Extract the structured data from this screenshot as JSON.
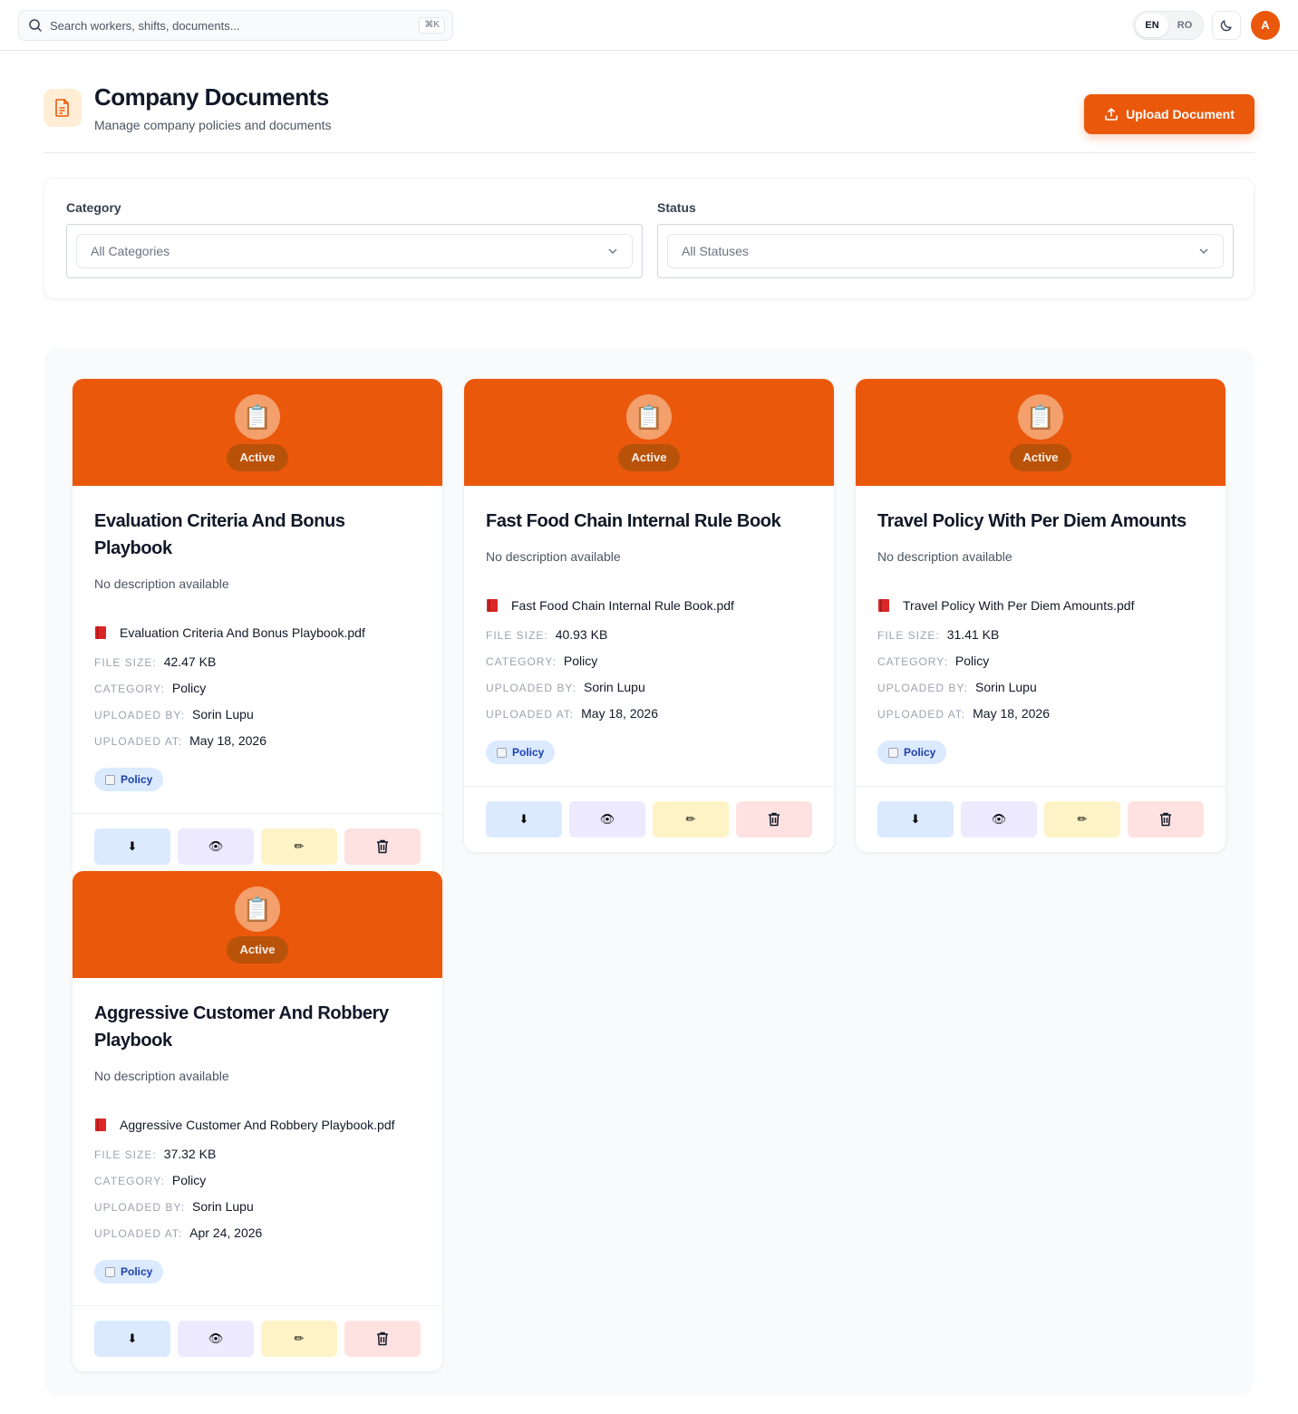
{
  "topbar": {
    "search_placeholder": "Search workers, shifts, documents...",
    "shortcut": "⌘K",
    "lang": [
      "EN",
      "RO"
    ],
    "avatar_initial": "A"
  },
  "header": {
    "title": "Company Documents",
    "subtitle": "Manage company policies and documents",
    "upload_label": "Upload Document"
  },
  "filters": {
    "category_label": "Category",
    "category_value": "All Categories",
    "status_label": "Status",
    "status_value": "All Statuses"
  },
  "labels": {
    "file_size": "FILE SIZE:",
    "category": "CATEGORY:",
    "uploaded_by": "UPLOADED BY:",
    "uploaded_at": "UPLOADED AT:"
  },
  "colors": {
    "accent": "#ea580c"
  },
  "documents": [
    {
      "status": "Active",
      "title": "Evaluation Criteria And Bonus Playbook",
      "description": "No description available",
      "file_name": "Evaluation Criteria And Bonus Playbook.pdf",
      "file_size": "42.47 KB",
      "category": "Policy",
      "uploaded_by": "Sorin Lupu",
      "uploaded_at": "May 18, 2026",
      "tag": "Policy"
    },
    {
      "status": "Active",
      "title": "Fast Food Chain Internal Rule Book",
      "description": "No description available",
      "file_name": "Fast Food Chain Internal Rule Book.pdf",
      "file_size": "40.93 KB",
      "category": "Policy",
      "uploaded_by": "Sorin Lupu",
      "uploaded_at": "May 18, 2026",
      "tag": "Policy"
    },
    {
      "status": "Active",
      "title": "Travel Policy With Per Diem Amounts",
      "description": "No description available",
      "file_name": "Travel Policy With Per Diem Amounts.pdf",
      "file_size": "31.41 KB",
      "category": "Policy",
      "uploaded_by": "Sorin Lupu",
      "uploaded_at": "May 18, 2026",
      "tag": "Policy"
    },
    {
      "status": "Active",
      "title": "Aggressive Customer And Robbery Playbook",
      "description": "No description available",
      "file_name": "Aggressive Customer And Robbery Playbook.pdf",
      "file_size": "37.32 KB",
      "category": "Policy",
      "uploaded_by": "Sorin Lupu",
      "uploaded_at": "Apr 24, 2026",
      "tag": "Policy"
    }
  ]
}
